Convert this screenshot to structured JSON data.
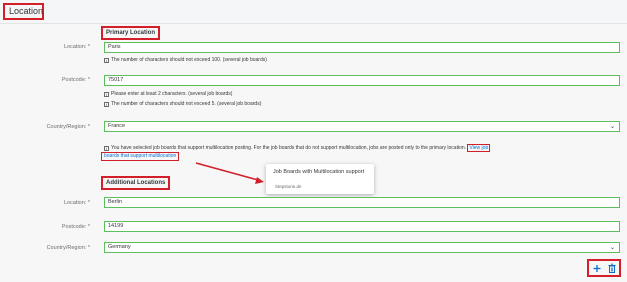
{
  "section": {
    "title": "Location"
  },
  "primary": {
    "heading": "Primary Location",
    "location_label": "Location: *",
    "location_value": "Paris",
    "location_hint": "The number of characters should not exceed 100. (several job boards)",
    "postcode_label": "Postcode: *",
    "postcode_value": "75017",
    "postcode_hint1": "Please enter at least 2 characters. (several job boards)",
    "postcode_hint2": "The number of characters should not exceed 5. (several job boards)",
    "country_label": "Country/Region: *",
    "country_value": "France"
  },
  "notice": {
    "text": "You have selected job boards that support multilocation posting. For the job boards that do not support multilocation, jobs are posted only to the primary location.",
    "link_part1": "View job",
    "link_part2": "boards that support multilocation"
  },
  "popover": {
    "title": "Job Boards with Multilocation support",
    "items": [
      "Stepstone.de"
    ]
  },
  "additional": {
    "heading": "Additional Locations",
    "location_label": "Location: *",
    "location_value": "Berlin",
    "postcode_label": "Postcode: *",
    "postcode_value": "14199",
    "country_label": "Country/Region: *",
    "country_value": "Germany"
  },
  "actions": {
    "add_icon": "plus-icon",
    "delete_icon": "trash-icon"
  },
  "colors": {
    "highlight": "#d21f2a",
    "valid_border": "#5bc05b",
    "link": "#0a6ed1"
  }
}
